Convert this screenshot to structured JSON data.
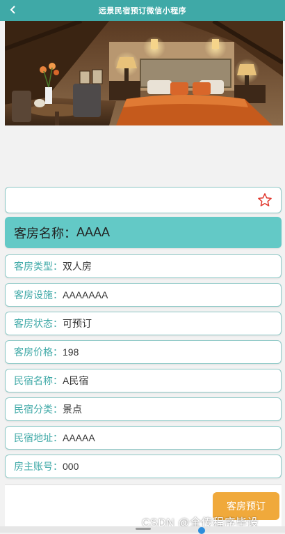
{
  "nav": {
    "title": "远景民宿预订微信小程序",
    "back_icon": "chevron-left-icon"
  },
  "detail": {
    "name_prefix": "客房名称：",
    "name": "AAAA",
    "fields": [
      {
        "label": "客房类型：",
        "value": "双人房"
      },
      {
        "label": "客房设施：",
        "value": "AAAAAAA"
      },
      {
        "label": "客房状态：",
        "value": "可预订"
      },
      {
        "label": "客房价格：",
        "value": "198"
      },
      {
        "label": "民宿名称：",
        "value": "A民宿"
      },
      {
        "label": "民宿分类：",
        "value": "景点"
      },
      {
        "label": "民宿地址：",
        "value": "AAAAA"
      },
      {
        "label": "房主账号：",
        "value": "000"
      }
    ]
  },
  "actions": {
    "book_label": "客房预订",
    "favorite_icon": "star-outline-icon"
  },
  "watermark": "CSDN @全传程序毕设",
  "colors": {
    "theme": "#3fa9a7",
    "title_bg": "#63c9c6",
    "button": "#f0a93b",
    "star": "#e0352b"
  }
}
